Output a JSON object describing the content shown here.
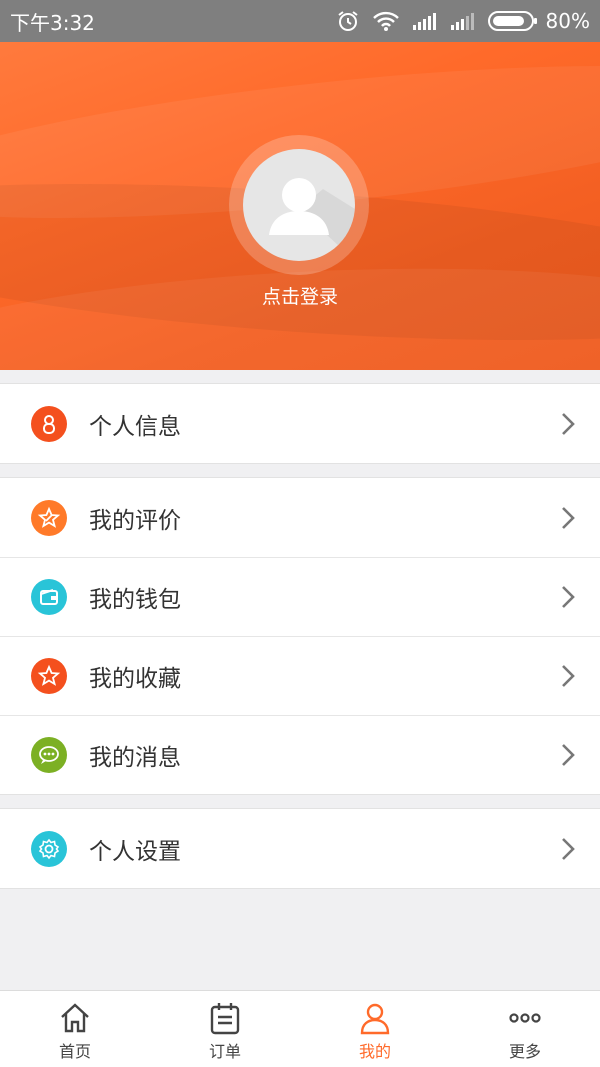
{
  "status_bar": {
    "time": "下午3:32",
    "battery": "80%"
  },
  "header": {
    "login_label": "点击登录"
  },
  "menu_groups": [
    [
      {
        "label": "个人信息",
        "icon": "person-icon",
        "color": "#f4501e"
      }
    ],
    [
      {
        "label": "我的评价",
        "icon": "review-star-icon",
        "color": "#ff7a29"
      },
      {
        "label": "我的钱包",
        "icon": "wallet-icon",
        "color": "#29c4d8"
      },
      {
        "label": "我的收藏",
        "icon": "star-icon",
        "color": "#f4501e"
      },
      {
        "label": "我的消息",
        "icon": "message-icon",
        "color": "#7cb024"
      }
    ],
    [
      {
        "label": "个人设置",
        "icon": "settings-icon",
        "color": "#29c4d8"
      }
    ]
  ],
  "tabbar": [
    {
      "label": "首页",
      "icon": "home-icon",
      "active": false
    },
    {
      "label": "订单",
      "icon": "order-icon",
      "active": false
    },
    {
      "label": "我的",
      "icon": "profile-icon",
      "active": true
    },
    {
      "label": "更多",
      "icon": "more-icon",
      "active": false
    }
  ],
  "colors": {
    "accent": "#ff6a2a",
    "status_bar": "#7f7f7f",
    "background": "#f0f0f2"
  }
}
